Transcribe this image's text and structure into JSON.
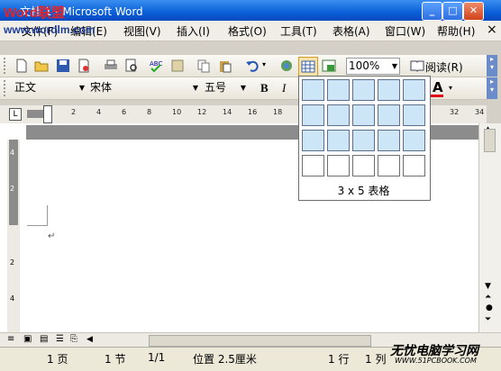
{
  "window": {
    "title": "文档 1 - Microsoft Word",
    "watermark_logo": "Word联盟",
    "watermark_url": "www.wordlm.com"
  },
  "menu": [
    "文件(F)",
    "编辑(E)",
    "视图(V)",
    "插入(I)",
    "格式(O)",
    "工具(T)",
    "表格(A)",
    "窗口(W)",
    "帮助(H)"
  ],
  "menu_close": "×",
  "toolbar1": {
    "zoom": "100%",
    "reading": "阅读(R)"
  },
  "toolbar2": {
    "style": "正文",
    "font": "宋体",
    "size": "五号",
    "bold": "B",
    "italic": "I",
    "font_color_letter": "A"
  },
  "ruler": {
    "ticks": [
      "2",
      "4",
      "6",
      "8",
      "10",
      "12",
      "14",
      "16",
      "18",
      "20",
      "22",
      "24",
      "26",
      "28",
      "30",
      "32",
      "34"
    ]
  },
  "insert_table_grid": {
    "rows": 4,
    "cols": 5,
    "selected_rows": 3,
    "selected_cols": 5,
    "caption": "3 x 5 表格"
  },
  "paragraph_mark": "↵",
  "statusbar": {
    "page": "1 页",
    "section": "1 节",
    "page_of": "1/1",
    "position": "位置 2.5厘米",
    "line": "1 行",
    "column": "1 列"
  },
  "watermark_bottom": {
    "text": "无忧电脑学习网",
    "url": "WWW.51PCBOOK.COM"
  },
  "colors": {
    "titlebar": "#0a5fd8",
    "grid_selected": "#cde6f7",
    "font_color": "#e0001a"
  }
}
